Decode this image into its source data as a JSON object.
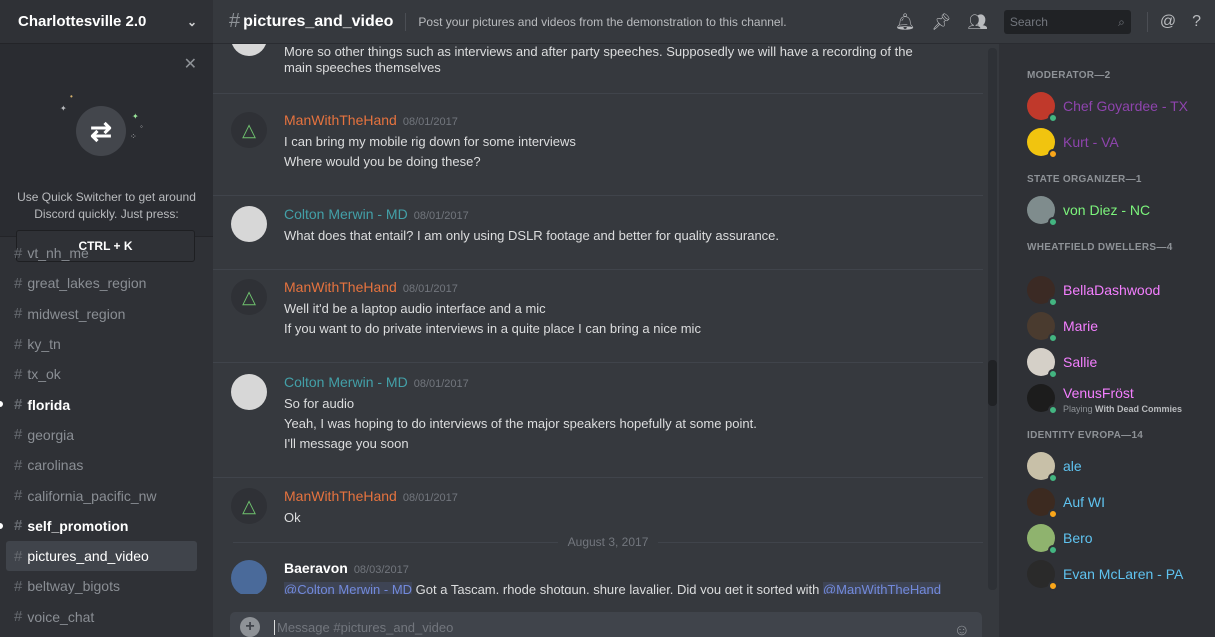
{
  "server": {
    "name": "Charlottesville 2.0"
  },
  "quick_switcher": {
    "text": "Use Quick Switcher to get around Discord quickly. Just press:",
    "shortcut": "CTRL + K"
  },
  "channels": [
    {
      "name": "vt_nh_me",
      "state": "normal"
    },
    {
      "name": "great_lakes_region",
      "state": "normal"
    },
    {
      "name": "midwest_region",
      "state": "normal"
    },
    {
      "name": "ky_tn",
      "state": "normal"
    },
    {
      "name": "tx_ok",
      "state": "normal"
    },
    {
      "name": "florida",
      "state": "unread"
    },
    {
      "name": "georgia",
      "state": "normal"
    },
    {
      "name": "carolinas",
      "state": "normal"
    },
    {
      "name": "california_pacific_nw",
      "state": "normal"
    },
    {
      "name": "self_promotion",
      "state": "unread"
    },
    {
      "name": "pictures_and_video",
      "state": "active"
    },
    {
      "name": "beltway_bigots",
      "state": "normal"
    },
    {
      "name": "voice_chat",
      "state": "normal"
    }
  ],
  "header": {
    "channel": "pictures_and_video",
    "topic": "Post your pictures and videos from the demonstration to this channel.",
    "search_placeholder": "Search"
  },
  "messages": [
    {
      "author": "",
      "time": "",
      "lines": [
        "More so other things such as interviews and after party speeches. Supposedly we will have a recording of the main speeches themselves"
      ]
    },
    {
      "author": "ManWithTheHand",
      "time": "08/01/2017",
      "lines": [
        "I can bring my mobile rig down for some interviews",
        "Where would you be doing these?"
      ]
    },
    {
      "author": "Colton Merwin - MD",
      "time": "08/01/2017",
      "lines": [
        "What does that entail? I am only using DSLR footage and better for quality assurance."
      ]
    },
    {
      "author": "ManWithTheHand",
      "time": "08/01/2017",
      "lines": [
        "Well it'd be a laptop audio interface and a mic",
        "If you want to do private interviews in a quite place I can bring a nice mic"
      ]
    },
    {
      "author": "Colton Merwin - MD",
      "time": "08/01/2017",
      "lines": [
        "So for audio",
        "Yeah, I was hoping to do interviews of the major speakers hopefully at some point.",
        "I'll message you soon"
      ]
    },
    {
      "author": "ManWithTheHand",
      "time": "08/01/2017",
      "lines": [
        "Ok"
      ]
    },
    {
      "author": "Baeravon",
      "time": "08/03/2017",
      "mention1": "@Colton Merwin - MD",
      "text_mid": " Got a Tascam, rhode shotgun, shure lavalier. Did you get it sorted with ",
      "mention2": "@ManWithTheHand"
    }
  ],
  "date_divider": "August 3, 2017",
  "composer": {
    "placeholder": "Message #pictures_and_video"
  },
  "member_groups": [
    {
      "title": "MODERATOR—2",
      "members": [
        {
          "name": "Chef Goyardee - TX",
          "color": "#8e44ad",
          "status": "#43b581"
        },
        {
          "name": "Kurt - VA",
          "color": "#8e44ad",
          "status": "#faa61a"
        }
      ]
    },
    {
      "title": "STATE ORGANIZER—1",
      "members": [
        {
          "name": "von Diez - NC",
          "color": "#7cf47c",
          "status": "#43b581"
        }
      ]
    },
    {
      "title": "WHEATFIELD DWELLERS—4",
      "members": [
        {
          "name": "BellaDashwood",
          "color": "#f47fff",
          "status": "#43b581"
        },
        {
          "name": "Marie",
          "color": "#f47fff",
          "status": "#43b581"
        },
        {
          "name": "Sallie",
          "color": "#f47fff",
          "status": "#43b581"
        },
        {
          "name": "VenusFröst",
          "color": "#f47fff",
          "status": "#43b581",
          "playing_prefix": "Playing ",
          "playing": "With Dead Commies"
        }
      ]
    },
    {
      "title": "IDENTITY EVROPA—14",
      "members": [
        {
          "name": "ale",
          "color": "#5fc3f0",
          "status": "#43b581"
        },
        {
          "name": "Auf WI",
          "color": "#5fc3f0",
          "status": "#faa61a"
        },
        {
          "name": "Bero",
          "color": "#5fc3f0",
          "status": "#43b581"
        },
        {
          "name": "Evan McLaren - PA",
          "color": "#5fc3f0",
          "status": "#faa61a"
        }
      ]
    }
  ],
  "colors": {
    "author_orange": "#e6733e",
    "author_teal": "#43a0a8",
    "author_white": "#ffffff"
  }
}
